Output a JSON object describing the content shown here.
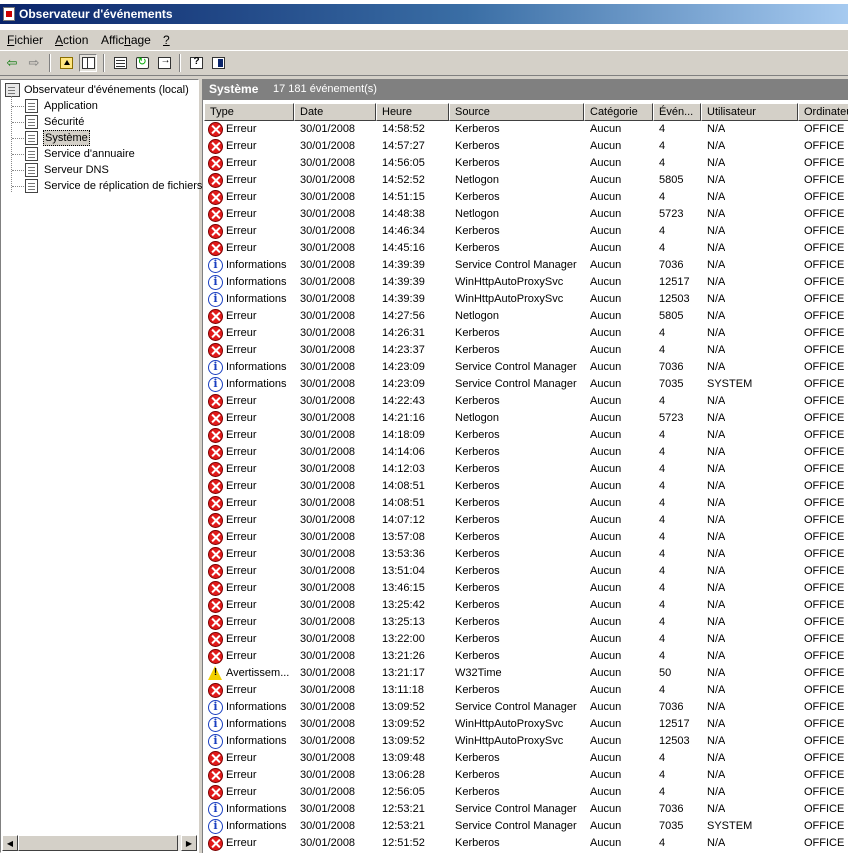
{
  "window": {
    "title": "Observateur d'événements"
  },
  "menu": [
    {
      "pre": "",
      "u": "F",
      "post": "ichier"
    },
    {
      "pre": "",
      "u": "A",
      "post": "ction"
    },
    {
      "pre": "Affic",
      "u": "h",
      "post": "age"
    },
    {
      "pre": "",
      "u": "?",
      "post": ""
    }
  ],
  "toolbar": [
    "back-icon",
    "forward-icon",
    "up-folder-icon",
    "show-hide-tree-icon",
    "properties-icon",
    "refresh-icon",
    "export-list-icon",
    "help-icon",
    "console-icon"
  ],
  "tree": {
    "root": "Observateur d'événements (local)",
    "items": [
      "Application",
      "Sécurité",
      "Système",
      "Service d'annuaire",
      "Serveur DNS",
      "Service de réplication de fichiers"
    ],
    "selected": "Système"
  },
  "pane": {
    "title": "Système",
    "count": "17 181 événement(s)"
  },
  "columns": [
    "Type",
    "Date",
    "Heure",
    "Source",
    "Catégorie",
    "Évén...",
    "Utilisateur",
    "Ordinateur"
  ],
  "rows": [
    [
      "error",
      "Erreur",
      "30/01/2008",
      "14:58:52",
      "Kerberos",
      "Aucun",
      "4",
      "N/A",
      "OFFICE"
    ],
    [
      "error",
      "Erreur",
      "30/01/2008",
      "14:57:27",
      "Kerberos",
      "Aucun",
      "4",
      "N/A",
      "OFFICE"
    ],
    [
      "error",
      "Erreur",
      "30/01/2008",
      "14:56:05",
      "Kerberos",
      "Aucun",
      "4",
      "N/A",
      "OFFICE"
    ],
    [
      "error",
      "Erreur",
      "30/01/2008",
      "14:52:52",
      "Netlogon",
      "Aucun",
      "5805",
      "N/A",
      "OFFICE"
    ],
    [
      "error",
      "Erreur",
      "30/01/2008",
      "14:51:15",
      "Kerberos",
      "Aucun",
      "4",
      "N/A",
      "OFFICE"
    ],
    [
      "error",
      "Erreur",
      "30/01/2008",
      "14:48:38",
      "Netlogon",
      "Aucun",
      "5723",
      "N/A",
      "OFFICE"
    ],
    [
      "error",
      "Erreur",
      "30/01/2008",
      "14:46:34",
      "Kerberos",
      "Aucun",
      "4",
      "N/A",
      "OFFICE"
    ],
    [
      "error",
      "Erreur",
      "30/01/2008",
      "14:45:16",
      "Kerberos",
      "Aucun",
      "4",
      "N/A",
      "OFFICE"
    ],
    [
      "info",
      "Informations",
      "30/01/2008",
      "14:39:39",
      "Service Control Manager",
      "Aucun",
      "7036",
      "N/A",
      "OFFICE"
    ],
    [
      "info",
      "Informations",
      "30/01/2008",
      "14:39:39",
      "WinHttpAutoProxySvc",
      "Aucun",
      "12517",
      "N/A",
      "OFFICE"
    ],
    [
      "info",
      "Informations",
      "30/01/2008",
      "14:39:39",
      "WinHttpAutoProxySvc",
      "Aucun",
      "12503",
      "N/A",
      "OFFICE"
    ],
    [
      "error",
      "Erreur",
      "30/01/2008",
      "14:27:56",
      "Netlogon",
      "Aucun",
      "5805",
      "N/A",
      "OFFICE"
    ],
    [
      "error",
      "Erreur",
      "30/01/2008",
      "14:26:31",
      "Kerberos",
      "Aucun",
      "4",
      "N/A",
      "OFFICE"
    ],
    [
      "error",
      "Erreur",
      "30/01/2008",
      "14:23:37",
      "Kerberos",
      "Aucun",
      "4",
      "N/A",
      "OFFICE"
    ],
    [
      "info",
      "Informations",
      "30/01/2008",
      "14:23:09",
      "Service Control Manager",
      "Aucun",
      "7036",
      "N/A",
      "OFFICE"
    ],
    [
      "info",
      "Informations",
      "30/01/2008",
      "14:23:09",
      "Service Control Manager",
      "Aucun",
      "7035",
      "SYSTEM",
      "OFFICE"
    ],
    [
      "error",
      "Erreur",
      "30/01/2008",
      "14:22:43",
      "Kerberos",
      "Aucun",
      "4",
      "N/A",
      "OFFICE"
    ],
    [
      "error",
      "Erreur",
      "30/01/2008",
      "14:21:16",
      "Netlogon",
      "Aucun",
      "5723",
      "N/A",
      "OFFICE"
    ],
    [
      "error",
      "Erreur",
      "30/01/2008",
      "14:18:09",
      "Kerberos",
      "Aucun",
      "4",
      "N/A",
      "OFFICE"
    ],
    [
      "error",
      "Erreur",
      "30/01/2008",
      "14:14:06",
      "Kerberos",
      "Aucun",
      "4",
      "N/A",
      "OFFICE"
    ],
    [
      "error",
      "Erreur",
      "30/01/2008",
      "14:12:03",
      "Kerberos",
      "Aucun",
      "4",
      "N/A",
      "OFFICE"
    ],
    [
      "error",
      "Erreur",
      "30/01/2008",
      "14:08:51",
      "Kerberos",
      "Aucun",
      "4",
      "N/A",
      "OFFICE"
    ],
    [
      "error",
      "Erreur",
      "30/01/2008",
      "14:08:51",
      "Kerberos",
      "Aucun",
      "4",
      "N/A",
      "OFFICE"
    ],
    [
      "error",
      "Erreur",
      "30/01/2008",
      "14:07:12",
      "Kerberos",
      "Aucun",
      "4",
      "N/A",
      "OFFICE"
    ],
    [
      "error",
      "Erreur",
      "30/01/2008",
      "13:57:08",
      "Kerberos",
      "Aucun",
      "4",
      "N/A",
      "OFFICE"
    ],
    [
      "error",
      "Erreur",
      "30/01/2008",
      "13:53:36",
      "Kerberos",
      "Aucun",
      "4",
      "N/A",
      "OFFICE"
    ],
    [
      "error",
      "Erreur",
      "30/01/2008",
      "13:51:04",
      "Kerberos",
      "Aucun",
      "4",
      "N/A",
      "OFFICE"
    ],
    [
      "error",
      "Erreur",
      "30/01/2008",
      "13:46:15",
      "Kerberos",
      "Aucun",
      "4",
      "N/A",
      "OFFICE"
    ],
    [
      "error",
      "Erreur",
      "30/01/2008",
      "13:25:42",
      "Kerberos",
      "Aucun",
      "4",
      "N/A",
      "OFFICE"
    ],
    [
      "error",
      "Erreur",
      "30/01/2008",
      "13:25:13",
      "Kerberos",
      "Aucun",
      "4",
      "N/A",
      "OFFICE"
    ],
    [
      "error",
      "Erreur",
      "30/01/2008",
      "13:22:00",
      "Kerberos",
      "Aucun",
      "4",
      "N/A",
      "OFFICE"
    ],
    [
      "error",
      "Erreur",
      "30/01/2008",
      "13:21:26",
      "Kerberos",
      "Aucun",
      "4",
      "N/A",
      "OFFICE"
    ],
    [
      "warning",
      "Avertissem...",
      "30/01/2008",
      "13:21:17",
      "W32Time",
      "Aucun",
      "50",
      "N/A",
      "OFFICE"
    ],
    [
      "error",
      "Erreur",
      "30/01/2008",
      "13:11:18",
      "Kerberos",
      "Aucun",
      "4",
      "N/A",
      "OFFICE"
    ],
    [
      "info",
      "Informations",
      "30/01/2008",
      "13:09:52",
      "Service Control Manager",
      "Aucun",
      "7036",
      "N/A",
      "OFFICE"
    ],
    [
      "info",
      "Informations",
      "30/01/2008",
      "13:09:52",
      "WinHttpAutoProxySvc",
      "Aucun",
      "12517",
      "N/A",
      "OFFICE"
    ],
    [
      "info",
      "Informations",
      "30/01/2008",
      "13:09:52",
      "WinHttpAutoProxySvc",
      "Aucun",
      "12503",
      "N/A",
      "OFFICE"
    ],
    [
      "error",
      "Erreur",
      "30/01/2008",
      "13:09:48",
      "Kerberos",
      "Aucun",
      "4",
      "N/A",
      "OFFICE"
    ],
    [
      "error",
      "Erreur",
      "30/01/2008",
      "13:06:28",
      "Kerberos",
      "Aucun",
      "4",
      "N/A",
      "OFFICE"
    ],
    [
      "error",
      "Erreur",
      "30/01/2008",
      "12:56:05",
      "Kerberos",
      "Aucun",
      "4",
      "N/A",
      "OFFICE"
    ],
    [
      "info",
      "Informations",
      "30/01/2008",
      "12:53:21",
      "Service Control Manager",
      "Aucun",
      "7036",
      "N/A",
      "OFFICE"
    ],
    [
      "info",
      "Informations",
      "30/01/2008",
      "12:53:21",
      "Service Control Manager",
      "Aucun",
      "7035",
      "SYSTEM",
      "OFFICE"
    ],
    [
      "error",
      "Erreur",
      "30/01/2008",
      "12:51:52",
      "Kerberos",
      "Aucun",
      "4",
      "N/A",
      "OFFICE"
    ]
  ]
}
